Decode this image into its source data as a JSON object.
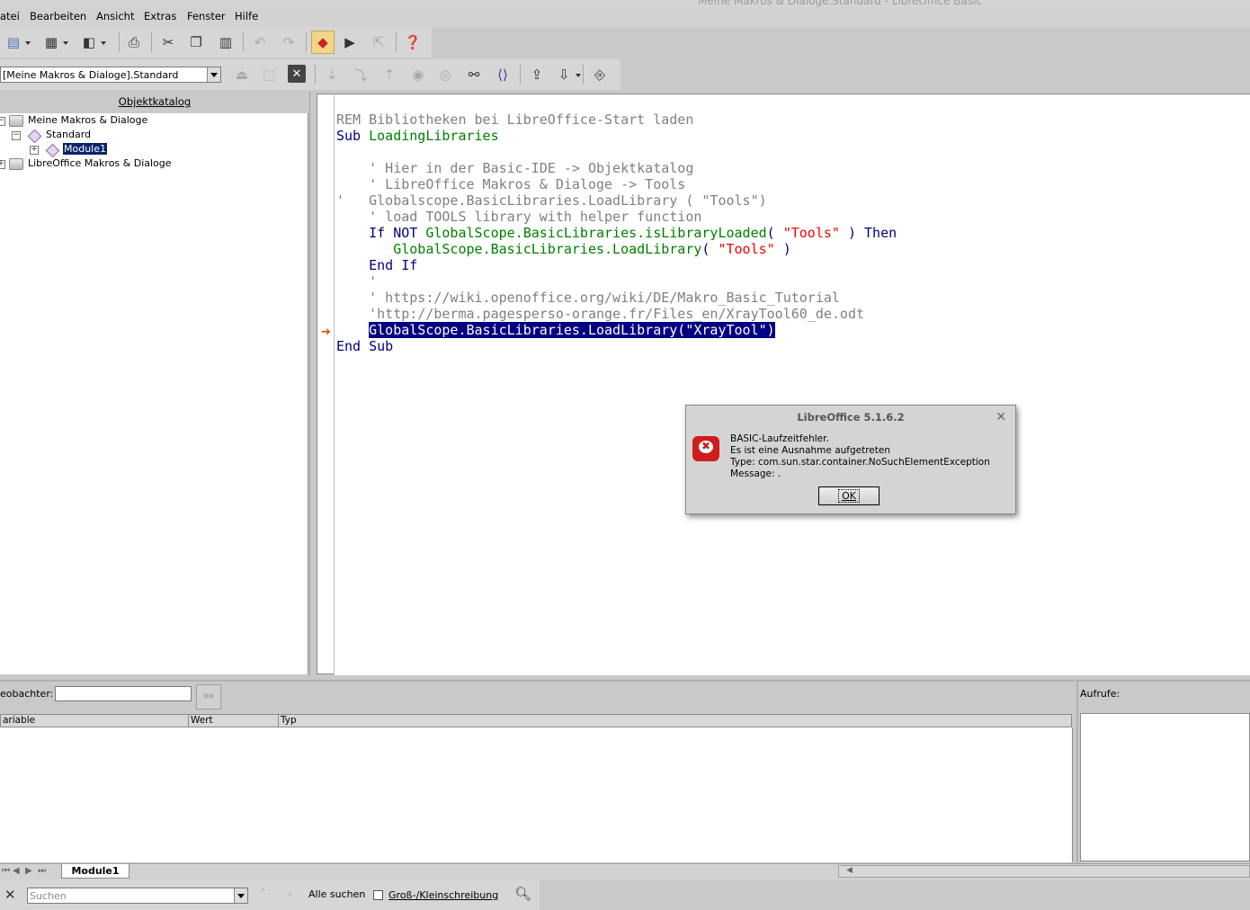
{
  "window": {
    "title": "Meine Makros & Dialoge.Standard - LibreOffice Basic"
  },
  "menu": [
    "atei",
    "Bearbeiten",
    "Ansicht",
    "Extras",
    "Fenster",
    "Hilfe"
  ],
  "library_select": {
    "value": "[Meine Makros & Dialoge].Standard"
  },
  "catalog": {
    "header": "Objektkatalog",
    "nodes": [
      "Meine Makros & Dialoge",
      "Standard",
      "Module1",
      "LibreOffice Makros & Dialoge"
    ],
    "selected": "Module1"
  },
  "code": {
    "lines": [
      [
        {
          "t": "REM Bibliotheken bei LibreOffice-Start laden",
          "c": "cm"
        }
      ],
      [
        {
          "t": "Sub ",
          "c": "kw"
        },
        {
          "t": "LoadingLibraries",
          "c": "id"
        }
      ],
      [],
      [
        {
          "t": "    ' Hier in der Basic-IDE -> Objektkatalog",
          "c": "cm"
        }
      ],
      [
        {
          "t": "    ' LibreOffice Makros & Dialoge -> Tools",
          "c": "cm"
        }
      ],
      [
        {
          "t": "'   Globalscope.BasicLibraries.LoadLibrary ( \"Tools\")",
          "c": "cm"
        }
      ],
      [
        {
          "t": "    ' load TOOLS library with helper function",
          "c": "cm"
        }
      ],
      [
        {
          "t": "    If NOT ",
          "c": "kw"
        },
        {
          "t": "GlobalScope.BasicLibraries.isLibraryLoaded",
          "c": "id"
        },
        {
          "t": "( ",
          "c": "kw"
        },
        {
          "t": "\"Tools\"",
          "c": "st"
        },
        {
          "t": " ) Then",
          "c": "kw"
        }
      ],
      [
        {
          "t": "       GlobalScope.BasicLibraries.LoadLibrary",
          "c": "id"
        },
        {
          "t": "( ",
          "c": "kw"
        },
        {
          "t": "\"Tools\"",
          "c": "st"
        },
        {
          "t": " )",
          "c": "kw"
        }
      ],
      [
        {
          "t": "    End If",
          "c": "kw"
        }
      ],
      [
        {
          "t": "    '",
          "c": "cm"
        }
      ],
      [
        {
          "t": "    ' https://wiki.openoffice.org/wiki/DE/Makro_Basic_Tutorial",
          "c": "cm"
        }
      ],
      [
        {
          "t": "    'http://berma.pagesperso-orange.fr/Files_en/XrayTool60_de.odt",
          "c": "cm"
        }
      ],
      [
        {
          "t": "    ",
          "c": ""
        },
        {
          "t": "GlobalScope.BasicLibraries.LoadLibrary(\"XrayTool\")",
          "c": "hl"
        }
      ],
      [
        {
          "t": "End Sub",
          "c": "kw"
        }
      ]
    ]
  },
  "dialog": {
    "title": "LibreOffice 5.1.6.2",
    "close_icon": "close-icon",
    "lines": [
      "BASIC-Laufzeitfehler.",
      "Es ist eine Ausnahme aufgetreten",
      "Type: com.sun.star.container.NoSuchElementException",
      "Message: ."
    ],
    "ok_label": "OK"
  },
  "watch": {
    "label": "eobachter:",
    "columns": [
      "ariable",
      "Wert",
      "Typ"
    ]
  },
  "calls": {
    "label": "Aufrufe:"
  },
  "tabs": {
    "active": "Module1"
  },
  "find": {
    "placeholder": "Suchen",
    "find_all": "Alle suchen",
    "match_case": "Groß-/Kleinschreibung"
  }
}
